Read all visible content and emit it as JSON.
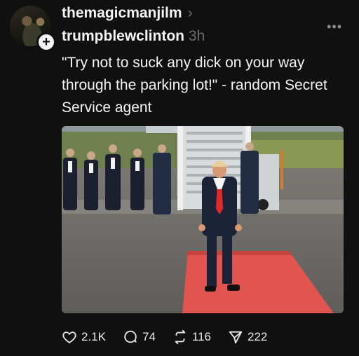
{
  "post": {
    "reposter": "themagicmanjilm",
    "author": "trumpblewclinton",
    "time": "3h",
    "text": "\"Try not to suck any dick on your way through the parking lot!\" - random Secret Service agent"
  },
  "icons": {
    "chevron": "›",
    "more": "•••",
    "plus": "+"
  },
  "actions": {
    "likes": "2.1K",
    "comments": "74",
    "reposts": "116",
    "shares": "222"
  },
  "colors": {
    "background": "#101010",
    "text": "#f3f5f7",
    "muted": "#6d6d6d",
    "carpet": "#e2544f"
  }
}
